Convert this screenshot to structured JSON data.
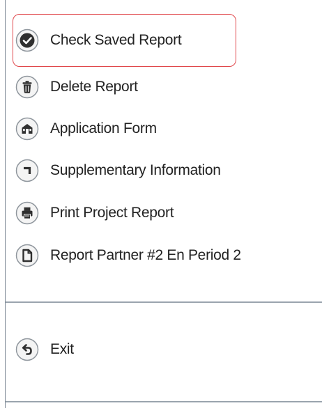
{
  "menu": {
    "items": [
      {
        "id": "check-saved-report",
        "label": "Check Saved Report",
        "icon": "check-icon",
        "selected": true
      },
      {
        "id": "delete-report",
        "label": "Delete Report",
        "icon": "trash-icon",
        "selected": false
      },
      {
        "id": "application-form",
        "label": "Application Form",
        "icon": "building-icon",
        "selected": false
      },
      {
        "id": "supplementary-information",
        "label": "Supplementary Information",
        "icon": "corner-arrow-icon",
        "selected": false
      },
      {
        "id": "print-project-report",
        "label": "Print Project Report",
        "icon": "printer-icon",
        "selected": false
      },
      {
        "id": "report-partner",
        "label": "Report Partner #2 En Period 2",
        "icon": "document-icon",
        "selected": false
      }
    ],
    "exit": {
      "label": "Exit",
      "icon": "exit-arrow-icon"
    }
  },
  "colors": {
    "selection_outline": "#e0474b",
    "icon_fill": "#2f2f2f",
    "icon_ring": "#8f969d",
    "text": "#222222",
    "separator": "#9aa4ae"
  }
}
